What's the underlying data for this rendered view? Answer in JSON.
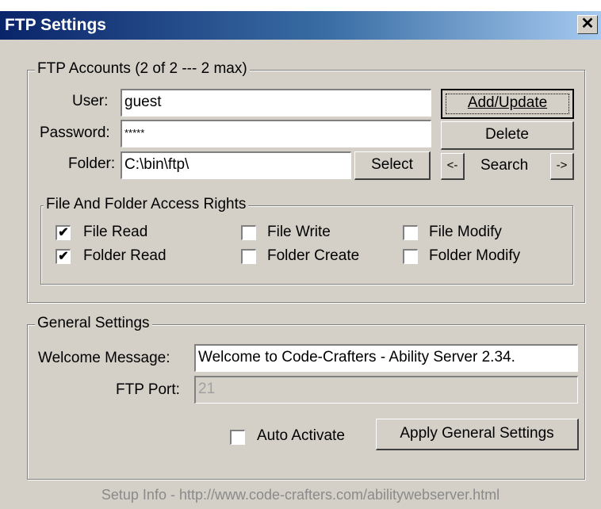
{
  "window": {
    "title": "FTP Settings",
    "close_glyph": "✕"
  },
  "accounts": {
    "legend": "FTP Accounts (2 of 2 --- 2 max)",
    "user_label": "User:",
    "user_value": "guest",
    "password_label": "Password:",
    "password_value": "*****",
    "folder_label": "Folder:",
    "folder_value": "C:\\bin\\ftp\\",
    "select_label": "Select",
    "add_update_label": "Add/Update",
    "delete_label": "Delete",
    "prev_label": "<-",
    "search_label": "Search",
    "next_label": "->"
  },
  "rights": {
    "legend": "File And Folder Access Rights",
    "items": [
      {
        "label": "File Read",
        "checked": true
      },
      {
        "label": "File Write",
        "checked": false
      },
      {
        "label": "File Modify",
        "checked": false
      },
      {
        "label": "Folder Read",
        "checked": true
      },
      {
        "label": "Folder Create",
        "checked": false
      },
      {
        "label": "Folder Modify",
        "checked": false
      }
    ]
  },
  "general": {
    "legend": "General Settings",
    "welcome_label": "Welcome Message:",
    "welcome_value": "Welcome to Code-Crafters - Ability Server 2.34.",
    "port_label": "FTP Port:",
    "port_value": "21",
    "auto_activate_label": "Auto Activate",
    "auto_activate_checked": false,
    "apply_label": "Apply General Settings"
  },
  "footer": {
    "text": "Setup Info - http://www.code-crafters.com/abilitywebserver.html"
  }
}
